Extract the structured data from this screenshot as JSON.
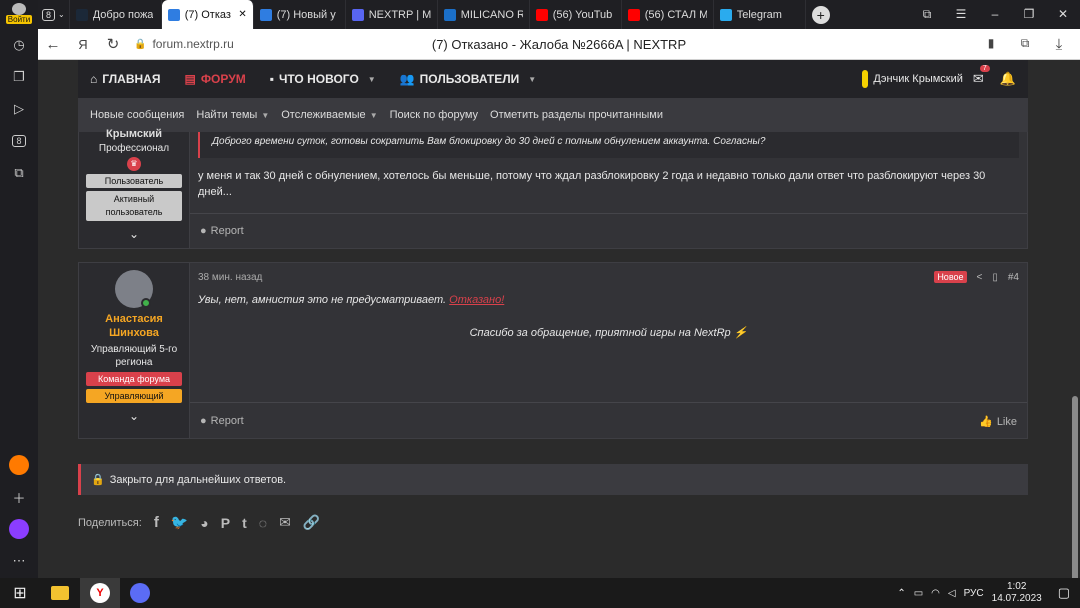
{
  "browser": {
    "login_label": "Войти",
    "tab_count": "8",
    "tabs": [
      {
        "title": "Добро пожа",
        "icon": "steam-icon",
        "color": "#1b2838"
      },
      {
        "title": "(7) Отказ",
        "icon": "forum-icon",
        "color": "#2f7de1",
        "active": true
      },
      {
        "title": "(7) Новый у",
        "icon": "forum-icon",
        "color": "#2f7de1"
      },
      {
        "title": "NEXTRP | M",
        "icon": "discord-icon",
        "color": "#5865f2"
      },
      {
        "title": "MILICANO R",
        "icon": "milicano-icon",
        "color": "#1b6fc8"
      },
      {
        "title": "(56) YouTub",
        "icon": "youtube-icon",
        "color": "#ff0000"
      },
      {
        "title": "(56) СТАЛ М",
        "icon": "youtube-icon",
        "color": "#ff0000"
      },
      {
        "title": "Telegram",
        "icon": "telegram-icon",
        "color": "#2aabee"
      }
    ],
    "url": "forum.nextrp.ru",
    "page_title": "(7) Отказано - Жалоба №2666A | NEXTRP"
  },
  "nav": {
    "home": "ГЛАВНАЯ",
    "forum": "ФОРУМ",
    "whats_new": "ЧТО НОВОГО",
    "users": "ПОЛЬЗОВАТЕЛИ",
    "username": "Дэнчик Крымский",
    "messages_count": "7"
  },
  "subnav": [
    "Новые сообщения",
    "Найти темы",
    "Отслеживаемые",
    "Поиск по форуму",
    "Отметить разделы прочитанными"
  ],
  "post1": {
    "user_name": "Крымский",
    "user_title": "Профессионал",
    "badges": [
      "Пользователь",
      "Активный пользователь"
    ],
    "quote": "Доброго времени суток, готовы сократить Вам блокировку до 30 дней с полным обнулением аккаунта. Согласны?",
    "text": "у меня и так 30 дней с обнулением, хотелось бы меньше, потому что ждал разблокировку 2 года и недавно только дали ответ что разблокируют через 30 дней...",
    "report": "Report"
  },
  "post2": {
    "time": "38 мин. назад",
    "new_badge": "Новое",
    "post_number": "#4",
    "user_name": "Анастасия Шинхова",
    "user_title": "Управляющий 5-го региона",
    "badge_team": "Команда форума",
    "badge_manager": "Управляющий",
    "text_main": "Увы, нет, амнистия это не предусматривает.",
    "text_status": "Отказано!",
    "thanks": "Спасибо за обращение, приятной игры на NextRp",
    "report": "Report",
    "like": "Like"
  },
  "closed_text": "Закрыто для дальнейших ответов.",
  "share_label": "Поделиться:",
  "taskbar": {
    "lang": "РУС",
    "time": "1:02",
    "date": "14.07.2023"
  },
  "colors": {
    "accent": "#d9414b",
    "orange": "#f5a623"
  }
}
